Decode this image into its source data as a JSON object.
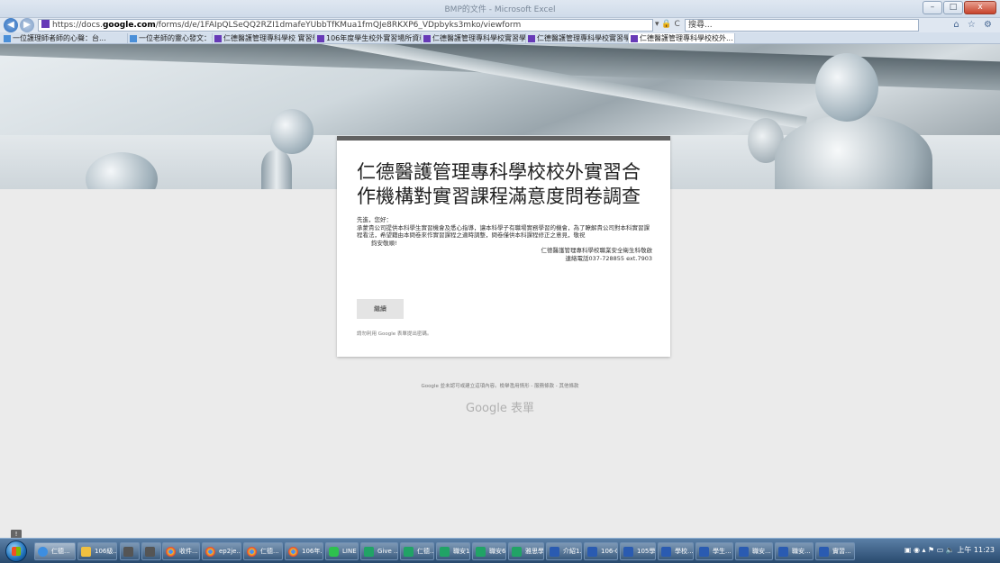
{
  "browser": {
    "url_prefix": "https://docs.",
    "url_domain": "google.com",
    "url_rest": "/forms/d/e/1FAIpQLSeQQ2RZI1dmafeYUbbTfKMua1fmQJe8RKXP6_VDpbyks3mko/viewform",
    "addr_icons": "▾ 🔒 C",
    "search_placeholder": "搜尋...",
    "window_title": "BMP的文件 - Microsoft Excel",
    "controls": {
      "minimize": "–",
      "maximize": "□",
      "close": "x"
    },
    "right_icons": "⌂ ☆ ⚙"
  },
  "tabs": [
    {
      "label": "一位護理師者師的心聲：台..."
    },
    {
      "label": "一位老師的靈心發文：台南人..."
    },
    {
      "label": "仁德醫護管理專科學校 實習學..."
    },
    {
      "label": "106年度學生校外實習場所資料"
    },
    {
      "label": "仁德醫護管理專科學校實習學..."
    },
    {
      "label": "仁德醫護管理專科學校實習學..."
    },
    {
      "label": "仁德醫護管理專科學校校外..."
    }
  ],
  "active_tab_close": "×",
  "form": {
    "title": "仁德醫護管理專科學校校外實習合作機構對實習課程滿意度問卷調查",
    "greeting": "先進，您好：",
    "paragraph": "承蒙貴公司提供本科學生實習機會及悉心指導，讓本科學子有職場實務學習的機會，為了瞭解貴公司對本科實習課程看法，希望藉由本問卷來作實習課程之適時調整，問卷僅供本科課程修正之意見，敬祝",
    "closing": "鈞安敬順!",
    "signature_line1": "仁德醫護管理專科學校職業安全衛生科敬啟",
    "signature_line2": "連絡電話037-728855 ext.7903",
    "continue_label": "繼續",
    "never_submit": "請勿利用 Google 表單提出密碼。"
  },
  "footer": {
    "note": "Google 並未認可或建立這項內容。檢舉濫用情形 - 服務條款 - 其他條款",
    "logo": "Google 表單"
  },
  "taskbar": {
    "buttons": [
      {
        "label": "仁德...",
        "icon": "ie"
      },
      {
        "label": "106級...",
        "icon": "folder"
      },
      {
        "label": "",
        "icon": "disp"
      },
      {
        "label": "",
        "icon": "disp"
      },
      {
        "label": "收件...",
        "icon": "chrome"
      },
      {
        "label": "ep2je...",
        "icon": "chrome"
      },
      {
        "label": "仁德...",
        "icon": "chrome"
      },
      {
        "label": "106年...",
        "icon": "chrome"
      },
      {
        "label": "LINE",
        "icon": "line"
      },
      {
        "label": "Give ...",
        "icon": "drive"
      },
      {
        "label": "仁德...",
        "icon": "drive"
      },
      {
        "label": "職安1...",
        "icon": "drive"
      },
      {
        "label": "職安6...",
        "icon": "drive"
      },
      {
        "label": "雅思學",
        "icon": "drive"
      },
      {
        "label": "介紹1...",
        "icon": "word"
      },
      {
        "label": "106-0...",
        "icon": "word"
      },
      {
        "label": "105學...",
        "icon": "word"
      },
      {
        "label": "學校...",
        "icon": "word"
      },
      {
        "label": "學生...",
        "icon": "word"
      },
      {
        "label": "職安...",
        "icon": "word"
      },
      {
        "label": "職安...",
        "icon": "word"
      },
      {
        "label": "實習...",
        "icon": "word"
      }
    ],
    "clock": "上午 11:23"
  }
}
